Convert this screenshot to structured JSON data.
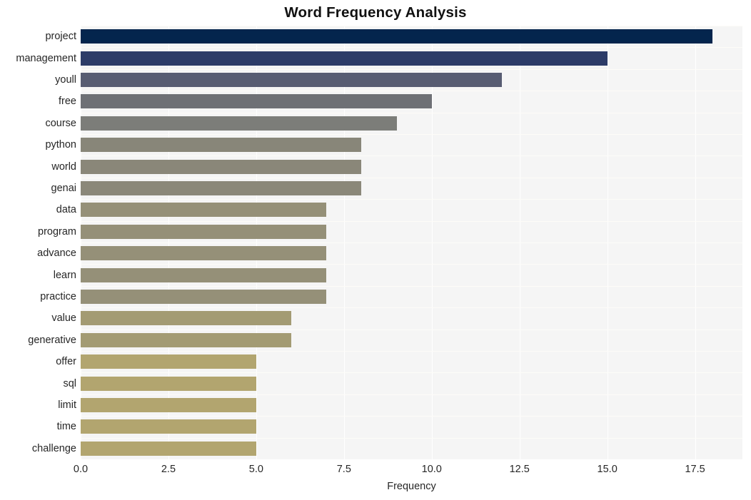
{
  "chart_data": {
    "type": "bar",
    "orientation": "horizontal",
    "title": "Word Frequency Analysis",
    "xlabel": "Frequency",
    "ylabel": "",
    "categories": [
      "project",
      "management",
      "youll",
      "free",
      "course",
      "python",
      "world",
      "genai",
      "data",
      "program",
      "advance",
      "learn",
      "practice",
      "value",
      "generative",
      "offer",
      "sql",
      "limit",
      "time",
      "challenge"
    ],
    "values": [
      18,
      15,
      12,
      10,
      9,
      8,
      8,
      8,
      7,
      7,
      7,
      7,
      7,
      6,
      6,
      5,
      5,
      5,
      5,
      5
    ],
    "bar_colors": [
      "#04254d",
      "#2d3c68",
      "#575c72",
      "#6e7075",
      "#7c7d79",
      "#888679",
      "#8a8779",
      "#8b8879",
      "#959078",
      "#959078",
      "#959078",
      "#959078",
      "#959078",
      "#a39b73",
      "#a39b73",
      "#b2a56f",
      "#b2a56f",
      "#b2a56f",
      "#b2a56f",
      "#b2a56f"
    ],
    "xlim": [
      0,
      18.85
    ],
    "x_ticks": [
      0.0,
      2.5,
      5.0,
      7.5,
      10.0,
      12.5,
      15.0,
      17.5
    ],
    "x_tick_labels": [
      "0.0",
      "2.5",
      "5.0",
      "7.5",
      "10.0",
      "12.5",
      "15.0",
      "17.5"
    ],
    "grid": true,
    "grid_axis": "both",
    "legend": false,
    "plot_background": "#f5f5f5",
    "figure_background": "#ffffff",
    "gridline_color": "#ffffff"
  }
}
